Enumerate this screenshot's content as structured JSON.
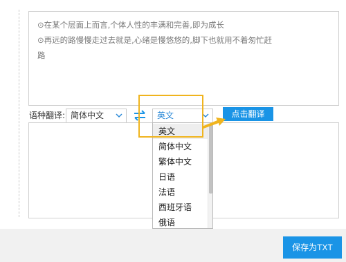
{
  "source_text": {
    "lines": [
      "⊙在某个层面上而言,个体人性的丰满和完善,即为成长",
      "⊙再远的路慢慢走过去就是,心绪是慢悠悠的,脚下也就用不着匆忙赶",
      "路"
    ]
  },
  "translate_bar": {
    "label": "语种翻译:",
    "source_lang": "简体中文",
    "target_lang": "英文",
    "translate_button": "点击翻译"
  },
  "dropdown": {
    "options": [
      "英文",
      "简体中文",
      "繁体中文",
      "日语",
      "法语",
      "西班牙语",
      "俄语"
    ],
    "selected_index": 0
  },
  "footer": {
    "save_button": "保存为TXT"
  },
  "colors": {
    "accent_blue": "#1a94e6",
    "highlight_orange": "#f0b41e",
    "target_text_blue": "#2c8ad8"
  }
}
